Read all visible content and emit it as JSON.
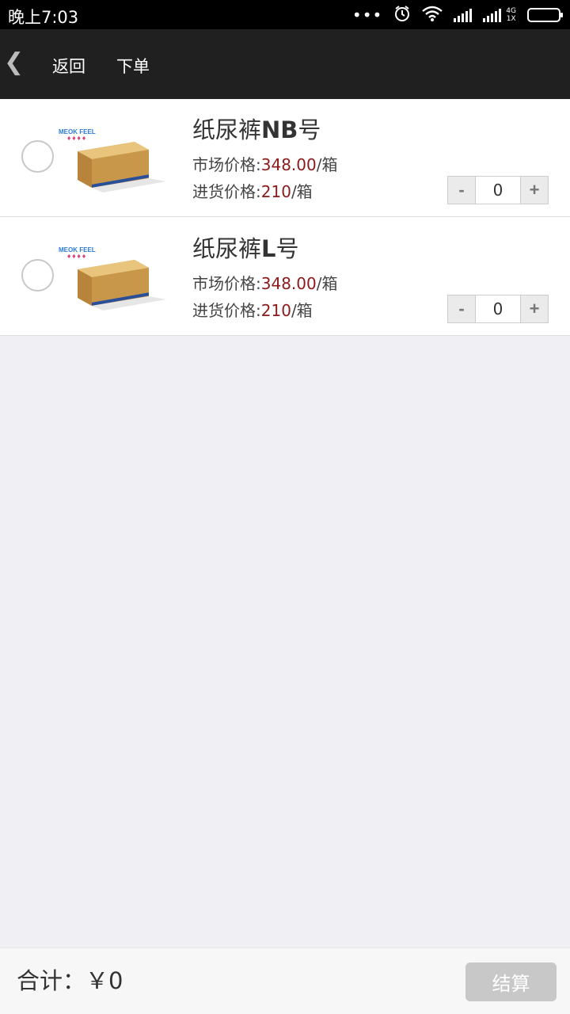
{
  "status_bar": {
    "time": "晚上7:03",
    "network": "4G",
    "network_sub": "1X",
    "icons": [
      "more-dots-icon",
      "alarm-icon",
      "wifi-icon",
      "signal-icon",
      "signal-4g-icon",
      "battery-icon"
    ]
  },
  "header": {
    "back_icon": "chevron-left-icon",
    "back_label": "返回",
    "title": "下单"
  },
  "products": [
    {
      "name_prefix": "纸尿裤",
      "name_size": "NB",
      "name_suffix": "号",
      "market_label": "市场价格:",
      "market_price": "348.00",
      "market_unit": "/箱",
      "purchase_label": "进货价格:",
      "purchase_price": "210",
      "purchase_unit": "/箱",
      "quantity": "0",
      "selected": false
    },
    {
      "name_prefix": "纸尿裤",
      "name_size": "L",
      "name_suffix": "号",
      "market_label": "市场价格:",
      "market_price": "348.00",
      "market_unit": "/箱",
      "purchase_label": "进货价格:",
      "purchase_price": "210",
      "purchase_unit": "/箱",
      "quantity": "0",
      "selected": false
    }
  ],
  "stepper": {
    "minus": "-",
    "plus": "+"
  },
  "footer": {
    "total_label": "合计：￥0",
    "checkout_label": "结算"
  },
  "colors": {
    "header_bg": "#202020",
    "price_accent": "#8b1a1a",
    "checkout_disabled": "#c8c8c8",
    "page_bg": "#efeff4"
  }
}
